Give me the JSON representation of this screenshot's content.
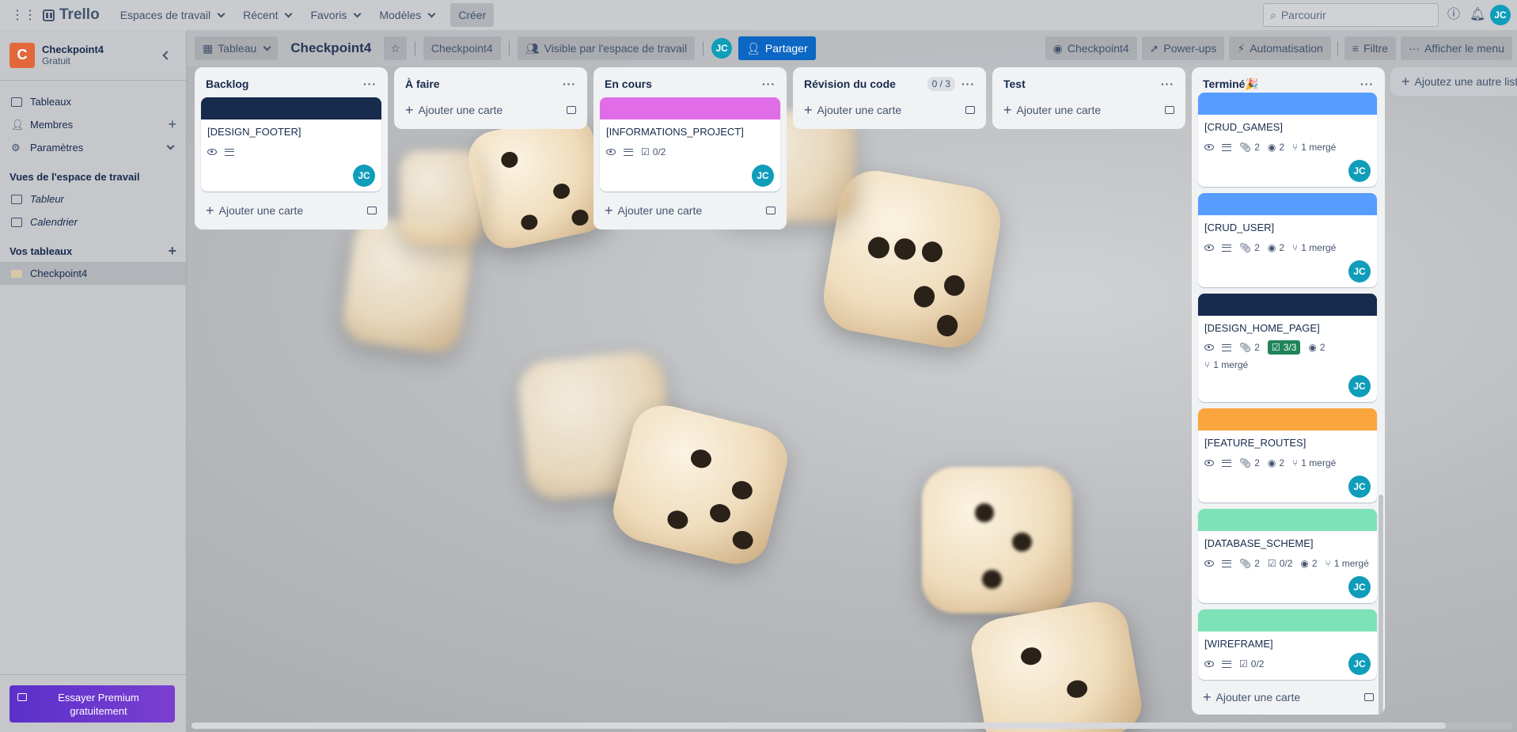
{
  "topbar": {
    "brand": "Trello",
    "menus": [
      "Espaces de travail",
      "Récent",
      "Favoris",
      "Modèles"
    ],
    "create": "Créer",
    "search_placeholder": "Parcourir",
    "user_initials": "JC"
  },
  "sidebar": {
    "workspace_initial": "C",
    "workspace_name": "Checkpoint4",
    "workspace_plan": "Gratuit",
    "items": [
      "Tableaux",
      "Membres",
      "Paramètres"
    ],
    "views_title": "Vues de l'espace de travail",
    "views": [
      "Tableur",
      "Calendrier"
    ],
    "boards_title": "Vos tableaux",
    "boards": [
      "Checkpoint4"
    ],
    "premium": "Essayer Premium gratuitement"
  },
  "board": {
    "view": "Tableau",
    "title": "Checkpoint4",
    "workspace": "Checkpoint4",
    "visibility": "Visible par l'espace de travail",
    "member": "JC",
    "share": "Partager",
    "right": [
      "Checkpoint4",
      "Power-ups",
      "Automatisation",
      "Filtre",
      "Afficher le menu"
    ],
    "add_list": "Ajoutez une autre liste",
    "add_card": "Ajouter une carte"
  },
  "lists": [
    {
      "title": "Backlog",
      "count": "",
      "cards": [
        {
          "cover": "#172b4d",
          "title": "[DESIGN_FOOTER]",
          "badges": [
            "eye",
            "desc"
          ]
        }
      ]
    },
    {
      "title": "À faire",
      "count": "",
      "cards": []
    },
    {
      "title": "En cours",
      "count": "",
      "cards": [
        {
          "cover": "#e06ce8",
          "title": "[INFORMATIONS_PROJECT]",
          "badges": [
            "eye",
            "desc",
            "0/2"
          ]
        }
      ]
    },
    {
      "title": "Révision du code",
      "count": "0 / 3",
      "cards": []
    },
    {
      "title": "Test",
      "count": "",
      "cards": []
    },
    {
      "title": "Terminé🎉",
      "count": "",
      "cards": [
        {
          "cover": "#579dff",
          "title": "[CRUD_GAMES]",
          "badges": [
            "eye",
            "desc",
            "2",
            "gh 2",
            "1 mergé"
          ]
        },
        {
          "cover": "#579dff",
          "title": "[CRUD_USER]",
          "badges": [
            "eye",
            "desc",
            "2",
            "gh 2",
            "1 mergé"
          ]
        },
        {
          "cover": "#172b4d",
          "title": "[DESIGN_HOME_PAGE]",
          "badges": [
            "eye",
            "desc",
            "2",
            "3/3",
            "gh 2",
            "1 mergé"
          ]
        },
        {
          "cover": "#faa53d",
          "title": "[FEATURE_ROUTES]",
          "badges": [
            "eye",
            "desc",
            "2",
            "gh 2",
            "1 mergé"
          ]
        },
        {
          "cover": "#7ee2b8",
          "title": "[DATABASE_SCHEME]",
          "badges": [
            "eye",
            "desc",
            "2",
            "0/2",
            "gh 2",
            "1 mergé"
          ]
        },
        {
          "cover": "#7ee2b8",
          "title": "[WIREFRAME]",
          "badges": [
            "eye",
            "desc",
            "0/2"
          ]
        }
      ]
    }
  ]
}
